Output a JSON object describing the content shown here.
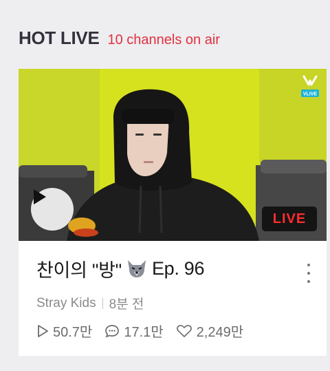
{
  "header": {
    "title": "HOT LIVE",
    "subtitle": "10 channels on air"
  },
  "card": {
    "badge": "LIVE",
    "brand": "VLIVE",
    "title_prefix": "찬이의 \"방\"",
    "title_suffix": "Ep. 96",
    "channel": "Stray Kids",
    "time_ago": "8분 전",
    "stats": {
      "plays": "50.7만",
      "comments": "17.1만",
      "likes": "2,249만"
    }
  },
  "colors": {
    "accent_red": "#e0313f",
    "live_red": "#ff2d2d",
    "thumb_bg": "#b8c912"
  }
}
